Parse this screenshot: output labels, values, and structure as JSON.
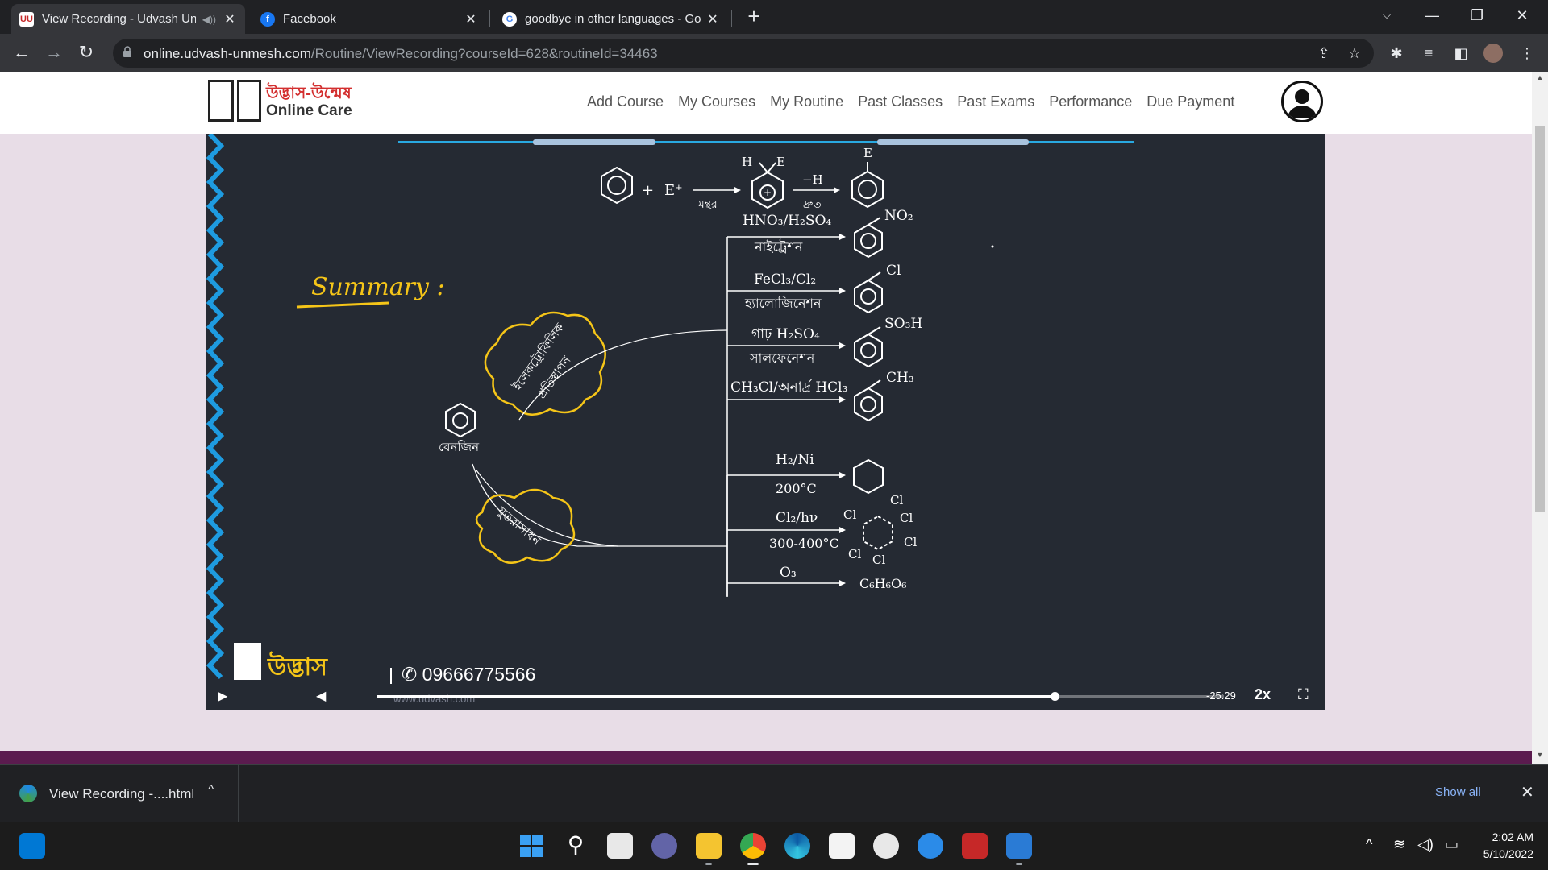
{
  "browser": {
    "tabs": [
      {
        "title": "View Recording - Udvash Un",
        "active": true,
        "favicon": "udvash-favicon",
        "audio": true
      },
      {
        "title": "Facebook",
        "active": false,
        "favicon": "facebook-favicon"
      },
      {
        "title": "goodbye in other languages - Go",
        "active": false,
        "favicon": "google-favicon"
      }
    ],
    "url_host": "online.udvash-unmesh.com",
    "url_path": "/Routine/ViewRecording?courseId=628&routineId=34463"
  },
  "site": {
    "logo_name": "উদ্ভাস-উন্মেষ",
    "logo_sub": "Online Care",
    "nav": [
      "Add Course",
      "My Courses",
      "My Routine",
      "Past Classes",
      "Past Exams",
      "Performance",
      "Due Payment"
    ]
  },
  "video": {
    "summary_label": "Summary :",
    "top_reaction": {
      "plus": "+",
      "electrophile": "E⁺",
      "slow": "মন্থর",
      "fast": "দ্রুত",
      "minus_h": "−H",
      "h": "H",
      "e1": "E",
      "e2": "E"
    },
    "reactions_substitution": [
      {
        "reagent": "HNO₃/H₂SO₄",
        "name": "নাইট্রেশন",
        "product": "NO₂"
      },
      {
        "reagent": "FeCl₃/Cl₂",
        "name": "হ্যালোজিনেশন",
        "product": "Cl"
      },
      {
        "reagent": "গাঢ় H₂SO₄",
        "name": "সালফেনেশন",
        "product": "SO₃H"
      },
      {
        "reagent": "CH₃Cl/অনার্দ্র HCl₃",
        "name": "",
        "product": "CH₃"
      }
    ],
    "substitution_cloud": [
      "ইলেকট্রোফিলিক",
      "প্রতিস্থাপন"
    ],
    "benzene_label": "বেনজিন",
    "addition_cloud": "যুতরাসাধন",
    "reactions_addition": [
      {
        "reagent": "H₂/Ni",
        "condition": "200°C"
      },
      {
        "reagent": "Cl₂/hν",
        "condition": "300-400°C"
      },
      {
        "reagent": "O₃",
        "condition": "",
        "product": "C₆H₆O₆"
      }
    ],
    "hexachloro_cl": [
      "Cl",
      "Cl",
      "Cl",
      "Cl",
      "Cl",
      "Cl"
    ],
    "brand": "উদ্ভাস",
    "phone": "09666775566",
    "watermark_url": "www.udvash.com",
    "time_remaining": "-25:29",
    "speed": "2x",
    "progress": 0.8
  },
  "downloads": {
    "file": "View Recording -....html",
    "show_all": "Show all"
  },
  "taskbar": {
    "time": "2:02 AM",
    "date": "5/10/2022"
  }
}
